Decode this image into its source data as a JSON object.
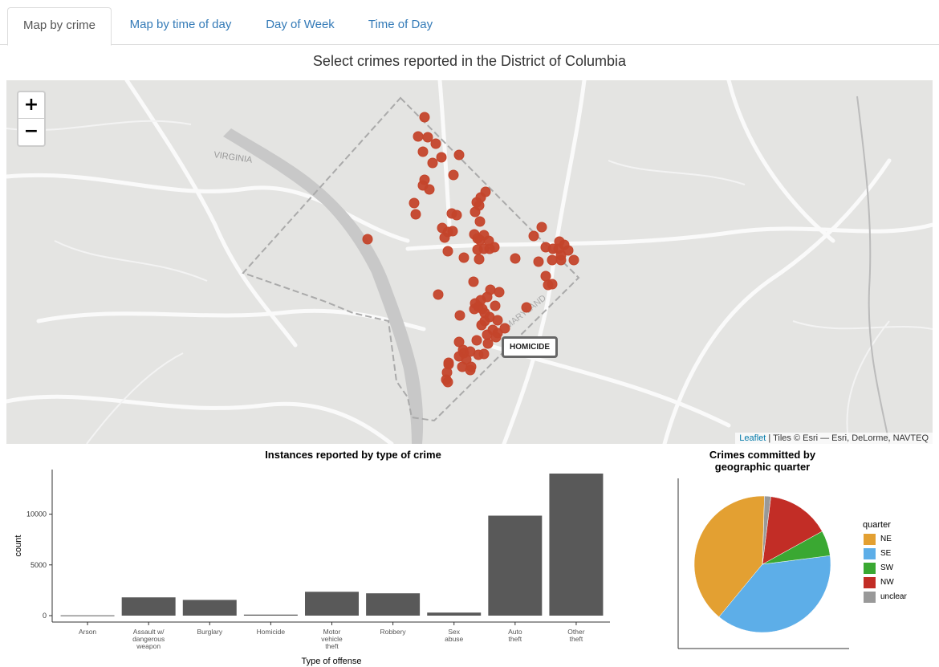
{
  "tabs": [
    {
      "label": "Map by crime",
      "active": true
    },
    {
      "label": "Map by time of day",
      "active": false
    },
    {
      "label": "Day of Week",
      "active": false
    },
    {
      "label": "Time of Day",
      "active": false
    }
  ],
  "map": {
    "title": "Select crimes reported in the District of Columbia",
    "zoom_in": "+",
    "zoom_out": "−",
    "label_virginia": "VIRGINIA",
    "label_maryland": "MARYLAND",
    "popup": "HOMICIDE",
    "attribution_link": "Leaflet",
    "attribution_text": " | Tiles © Esri — Esri, DeLorme, NAVTEQ",
    "marker_color": "#c4452b"
  },
  "chart_data": [
    {
      "type": "bar",
      "title": "Instances reported by type of crime",
      "xlabel": "Type of offense",
      "ylabel": "count",
      "categories": [
        "Arson",
        "Assault w/ dangerous weapon",
        "Burglary",
        "Homicide",
        "Motor vehicle theft",
        "Robbery",
        "Sex abuse",
        "Auto theft",
        "Other theft"
      ],
      "category_lines": [
        [
          "Arson"
        ],
        [
          "Assault w/",
          "dangerous",
          "weapon"
        ],
        [
          "Burglary"
        ],
        [
          "Homicide"
        ],
        [
          "Motor",
          "vehicle",
          "theft"
        ],
        [
          "Robbery"
        ],
        [
          "Sex",
          "abuse"
        ],
        [
          "Auto",
          "theft"
        ],
        [
          "Other",
          "theft"
        ]
      ],
      "values": [
        30,
        1800,
        1550,
        100,
        2350,
        2200,
        300,
        9850,
        14000
      ],
      "yticks": [
        0,
        5000,
        10000
      ],
      "ylim": [
        0,
        14000
      ],
      "bar_color": "#595959"
    },
    {
      "type": "pie",
      "title_lines": [
        "Crimes committed by",
        "geographic quarter"
      ],
      "legend_title": "quarter",
      "slices": [
        {
          "label": "NE",
          "value": 39.5,
          "color": "#e3a032"
        },
        {
          "label": "SE",
          "value": 38.0,
          "color": "#5daee8"
        },
        {
          "label": "SW",
          "value": 6.0,
          "color": "#3aa832"
        },
        {
          "label": "NW",
          "value": 15.0,
          "color": "#c22d26"
        },
        {
          "label": "unclear",
          "value": 1.5,
          "color": "#999999"
        }
      ]
    }
  ]
}
